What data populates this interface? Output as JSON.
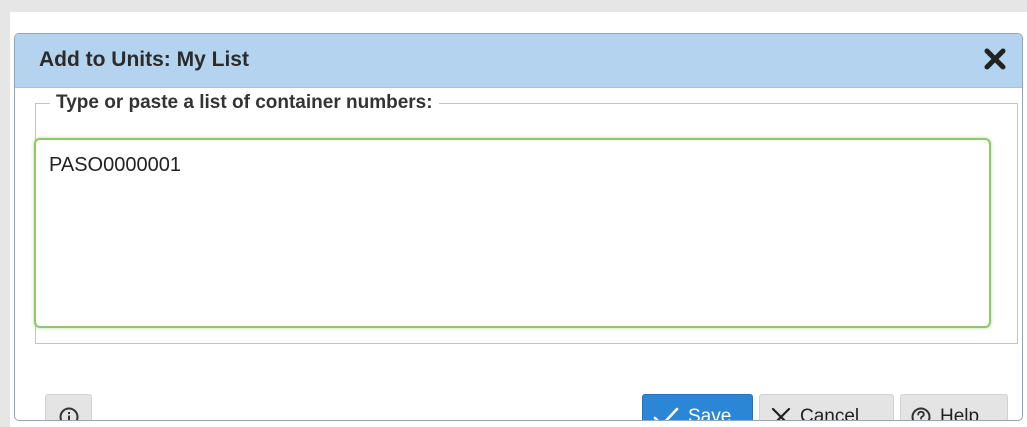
{
  "dialog": {
    "title": "Add to Units: My List",
    "close_icon": "close-icon",
    "group_legend": "Type or paste a list of container numbers:",
    "textarea_value": "PASO0000001"
  },
  "footer": {
    "info_icon": "info-icon",
    "save_label": "Save",
    "save_icon": "checkmark-icon",
    "cancel_label": "Cancel",
    "cancel_icon": "x-icon",
    "help_label": "Help",
    "help_icon": "question-circle-icon"
  },
  "colors": {
    "titlebar": "#b3d3ee",
    "save_button": "#2b86d6",
    "textarea_focus_border": "#8fc86a",
    "secondary_button": "#e4e4e4"
  }
}
